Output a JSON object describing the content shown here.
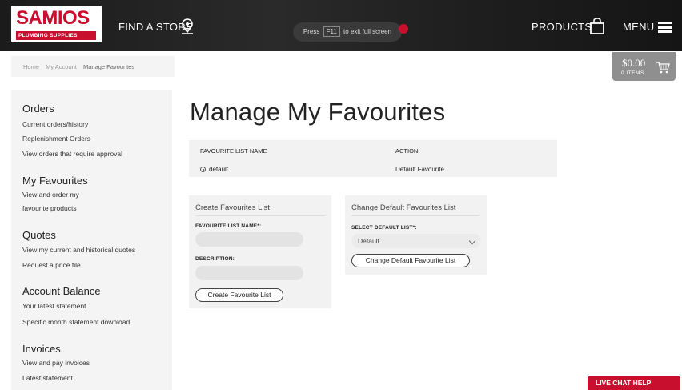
{
  "header": {
    "logo_main": "SAMIOS",
    "logo_sub": "PLUMBING SUPPLIES",
    "find_store": "FIND A STORE",
    "fullscreen_toast": {
      "before": "Press",
      "key": "F11",
      "after": "to exit full screen"
    },
    "products": "PRODUCTS",
    "menu": "MENU"
  },
  "breadcrumb": [
    "Home",
    "My Account",
    "Manage Favourites"
  ],
  "cart": {
    "amount": "$0.00",
    "items": "0 ITEMS"
  },
  "sidebar": {
    "sections": [
      {
        "heading": "Orders",
        "links": [
          "Current orders/history",
          "Replenishment Orders",
          "View orders that require approval"
        ]
      },
      {
        "heading": "My Favourites",
        "links": [
          "View and order my",
          "favourite products"
        ]
      },
      {
        "heading": "Quotes",
        "links": [
          "View my current and historical quotes",
          "Request a price file"
        ]
      },
      {
        "heading": "Account Balance",
        "links": [
          "Your latest statement",
          "Specific month statement download"
        ]
      },
      {
        "heading": "Invoices",
        "links": [
          "View and pay invoices",
          "Latest statement"
        ]
      }
    ]
  },
  "main": {
    "title": "Manage My Favourites",
    "table": {
      "col_name": "FAVOURITE LIST NAME",
      "col_action": "ACTION",
      "rows": [
        {
          "name": "default",
          "action": "Default Favourite"
        }
      ]
    },
    "create_panel": {
      "title": "Create Favourites List",
      "name_label": "FAVOURITE LIST NAME*:",
      "name_value": "",
      "desc_label": "DESCRIPTION:",
      "desc_value": "",
      "button": "Create Favourite List"
    },
    "change_panel": {
      "title": "Change Default Favourites List",
      "select_label": "SELECT DEFAULT LIST*:",
      "select_value": "Default",
      "button": "Change Default Favourite List"
    }
  },
  "live_chat": "LIVE CHAT HELP",
  "colors": {
    "brand_red": "#c8102e",
    "header_bg": "#1e1e1e",
    "panel_bg": "#f2f2f2"
  }
}
